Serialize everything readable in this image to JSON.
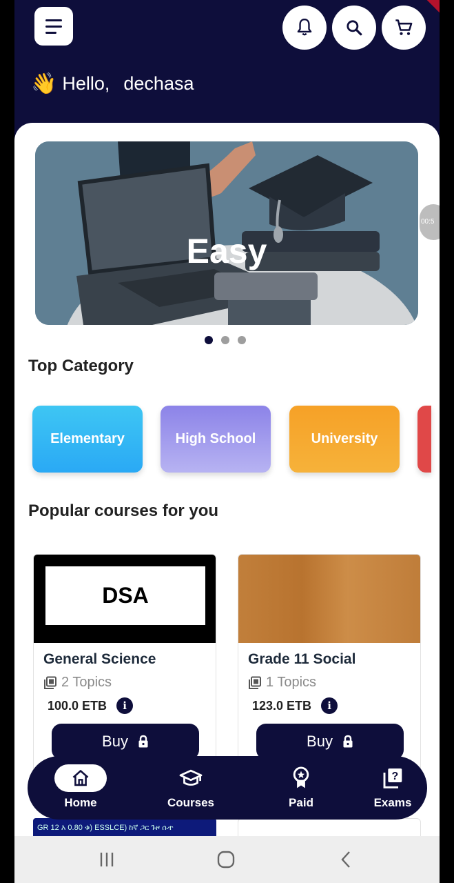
{
  "header": {
    "wave_emoji": "👋",
    "greeting": "Hello,",
    "user_name": "dechasa",
    "icons": [
      "menu-icon",
      "bell-icon",
      "search-icon",
      "cart-icon"
    ]
  },
  "banner": {
    "text": "Easy",
    "timer": "00:5",
    "slide_count": 3,
    "active_slide": 1
  },
  "top_category": {
    "title": "Top Category",
    "items": [
      {
        "label": "Elementary"
      },
      {
        "label": "High School"
      },
      {
        "label": "University"
      }
    ]
  },
  "popular": {
    "title": "Popular courses for you",
    "courses": [
      {
        "thumb_text": "DSA",
        "title": "General Science",
        "topics": "2 Topics",
        "price": "100.0 ETB",
        "buy_label": "Buy"
      },
      {
        "thumb_text": "",
        "title": "Grade 11 Social",
        "topics": "1 Topics",
        "price": "123.0 ETB",
        "buy_label": "Buy"
      }
    ],
    "peek_text": "GR 12 እ 0.80 ቁ) ESSLCE) ከኛ ጋር ጉዞ ሱተ"
  },
  "bottom_nav": {
    "items": [
      {
        "label": "Home",
        "icon": "home-icon",
        "active": true
      },
      {
        "label": "Courses",
        "icon": "graduation-cap-icon"
      },
      {
        "label": "Paid",
        "icon": "award-badge-icon"
      },
      {
        "label": "Exams",
        "icon": "question-copy-icon"
      }
    ]
  },
  "colors": {
    "navy": "#0e0e3b",
    "elementary": "#2aa9f5",
    "high_school": "#9c96ee",
    "university": "#f6a127"
  }
}
